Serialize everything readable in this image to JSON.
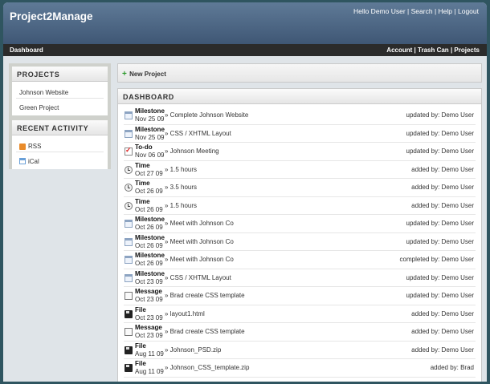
{
  "header": {
    "logo": "Project2Manage",
    "greeting": "Hello Demo User",
    "search_link": "Search",
    "help_link": "Help",
    "logout_link": "Logout",
    "separator": "|"
  },
  "nav": {
    "dashboard": "Dashboard",
    "account": "Account",
    "trash": "Trash Can",
    "projects": "Projects"
  },
  "sidebar": {
    "projects_heading": "PROJECTS",
    "projects": [
      "Johnson Website",
      "Green Project"
    ],
    "activity_heading": "RECENT ACTIVITY",
    "rss_label": "RSS",
    "ical_label": "iCal"
  },
  "toolbar": {
    "new_project_plus": "+",
    "new_project": "New Project"
  },
  "dashboard": {
    "heading": "DASHBOARD",
    "rows": [
      {
        "type": "Milestone",
        "icon": "milestone",
        "date": "Nov 25 09",
        "title": "» Complete Johnson Website",
        "status": "updated by: Demo User"
      },
      {
        "type": "Milestone",
        "icon": "milestone",
        "date": "Nov 25 09",
        "title": "» CSS / XHTML Layout",
        "status": "updated by: Demo User"
      },
      {
        "type": "To-do",
        "icon": "todo",
        "date": "Nov 06 09",
        "title": "» Johnson Meeting",
        "status": "updated by: Demo User"
      },
      {
        "type": "Time",
        "icon": "time",
        "date": "Oct 27 09",
        "title": "» 1.5 hours",
        "status": "added by: Demo User"
      },
      {
        "type": "Time",
        "icon": "time",
        "date": "Oct 26 09",
        "title": "» 3.5 hours",
        "status": "added by: Demo User"
      },
      {
        "type": "Time",
        "icon": "time",
        "date": "Oct 26 09",
        "title": "» 1.5 hours",
        "status": "added by: Demo User"
      },
      {
        "type": "Milestone",
        "icon": "milestone",
        "date": "Oct 26 09",
        "title": "» Meet with Johnson Co",
        "status": "updated by: Demo User"
      },
      {
        "type": "Milestone",
        "icon": "milestone",
        "date": "Oct 26 09",
        "title": "» Meet with Johnson Co",
        "status": "updated by: Demo User"
      },
      {
        "type": "Milestone",
        "icon": "milestone",
        "date": "Oct 26 09",
        "title": "» Meet with Johnson Co",
        "status": "completed by: Demo User"
      },
      {
        "type": "Milestone",
        "icon": "milestone",
        "date": "Oct 23 09",
        "title": "» CSS / XHTML Layout",
        "status": "updated by: Demo User"
      },
      {
        "type": "Message",
        "icon": "message",
        "date": "Oct 23 09",
        "title": "» Brad create CSS template",
        "status": "updated by: Demo User"
      },
      {
        "type": "File",
        "icon": "file",
        "date": "Oct 23 09",
        "title": "» layout1.html",
        "status": "added by: Demo User"
      },
      {
        "type": "Message",
        "icon": "message",
        "date": "Oct 23 09",
        "title": "» Brad create CSS template",
        "status": "added by: Demo User"
      },
      {
        "type": "File",
        "icon": "file",
        "date": "Aug 11 09",
        "title": "» Johnson_PSD.zip",
        "status": "added by: Demo User"
      },
      {
        "type": "File",
        "icon": "file",
        "date": "Aug 11 09",
        "title": "» Johnson_CSS_template.zip",
        "status": "added by: Brad"
      }
    ]
  }
}
